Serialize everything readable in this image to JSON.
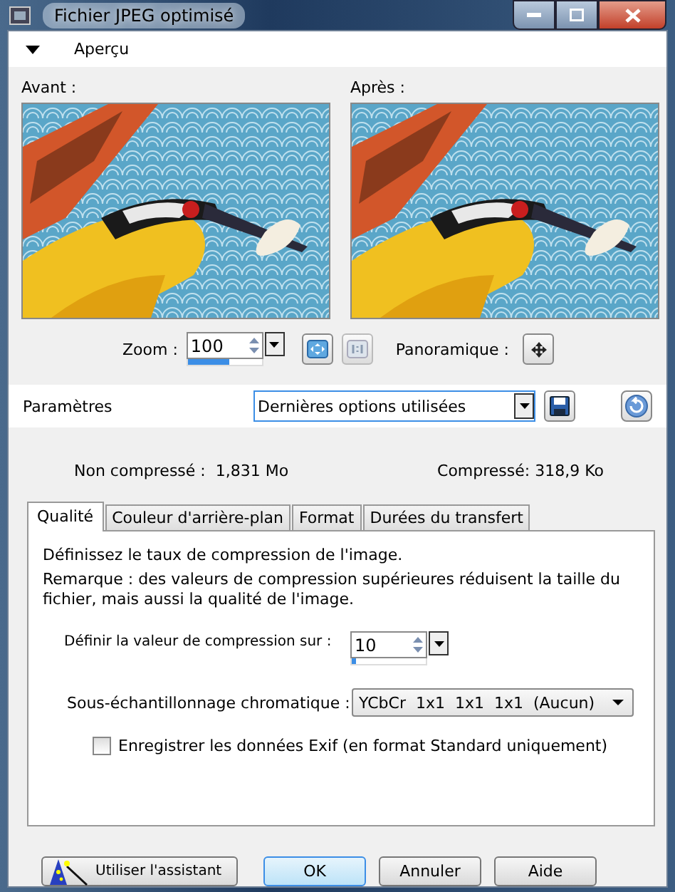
{
  "window": {
    "title": "Fichier JPEG optimisé"
  },
  "preview_section": {
    "label": "Aperçu",
    "expanded": true
  },
  "previews": [
    {
      "label": "Avant :"
    },
    {
      "label": "Après :"
    }
  ],
  "zoom": {
    "label": "Zoom :",
    "value": "100",
    "level": 0.55
  },
  "pan": {
    "label": "Panoramique :"
  },
  "presets": {
    "label": "Paramètres",
    "value": "Dernières options utilisées"
  },
  "sizes": {
    "uncompressed": "Non compressé :  1,831 Mo",
    "compressed": "Compressé: 318,9 Ko"
  },
  "tabs": [
    {
      "label": "Qualité",
      "selected": true
    },
    {
      "label": "Couleur d'arrière-plan",
      "selected": false
    },
    {
      "label": "Format",
      "selected": false
    },
    {
      "label": "Durées du transfert",
      "selected": false
    }
  ],
  "description": "Définissez le taux de compression de l'image.",
  "remark": "Remarque : des valeurs de compression supérieures réduisent la taille du fichier, mais aussi la qualité de l'image.",
  "compression": {
    "label": "Définir la valeur de compression sur :",
    "value": "10",
    "level": 0.06
  },
  "subsampling": {
    "label": "Sous-échantillonnage chromatique :",
    "value": "YCbCr  1x1  1x1  1x1  (Aucun)"
  },
  "exif": {
    "label": "Enregistrer les données Exif (en format Standard uniquement)",
    "checked": false
  },
  "buttons": [
    {
      "label": "Utiliser l'assistant",
      "kind": "wizard"
    },
    {
      "label": "OK",
      "kind": "default"
    },
    {
      "label": "Annuler",
      "kind": "plain"
    },
    {
      "label": "Aide",
      "kind": "plain"
    }
  ]
}
